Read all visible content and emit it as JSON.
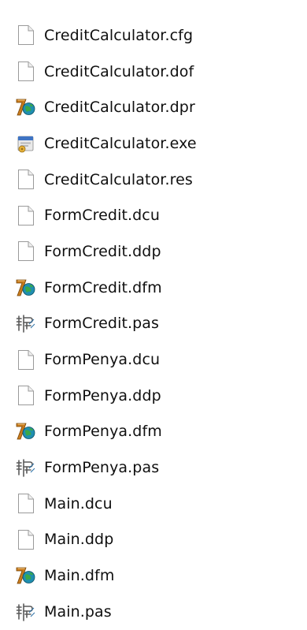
{
  "files": [
    {
      "name": "CreditCalculator.cfg",
      "icon": "blank-file-icon"
    },
    {
      "name": "CreditCalculator.dof",
      "icon": "blank-file-icon"
    },
    {
      "name": "CreditCalculator.dpr",
      "icon": "delphi-project-icon"
    },
    {
      "name": "CreditCalculator.exe",
      "icon": "application-exe-icon"
    },
    {
      "name": "CreditCalculator.res",
      "icon": "blank-file-icon"
    },
    {
      "name": "FormCredit.dcu",
      "icon": "blank-file-icon"
    },
    {
      "name": "FormCredit.ddp",
      "icon": "blank-file-icon"
    },
    {
      "name": "FormCredit.dfm",
      "icon": "delphi-project-icon"
    },
    {
      "name": "FormCredit.pas",
      "icon": "pascal-source-icon"
    },
    {
      "name": "FormPenya.dcu",
      "icon": "blank-file-icon"
    },
    {
      "name": "FormPenya.ddp",
      "icon": "blank-file-icon"
    },
    {
      "name": "FormPenya.dfm",
      "icon": "delphi-project-icon"
    },
    {
      "name": "FormPenya.pas",
      "icon": "pascal-source-icon"
    },
    {
      "name": "Main.dcu",
      "icon": "blank-file-icon"
    },
    {
      "name": "Main.ddp",
      "icon": "blank-file-icon"
    },
    {
      "name": "Main.dfm",
      "icon": "delphi-project-icon"
    },
    {
      "name": "Main.pas",
      "icon": "pascal-source-icon"
    }
  ]
}
